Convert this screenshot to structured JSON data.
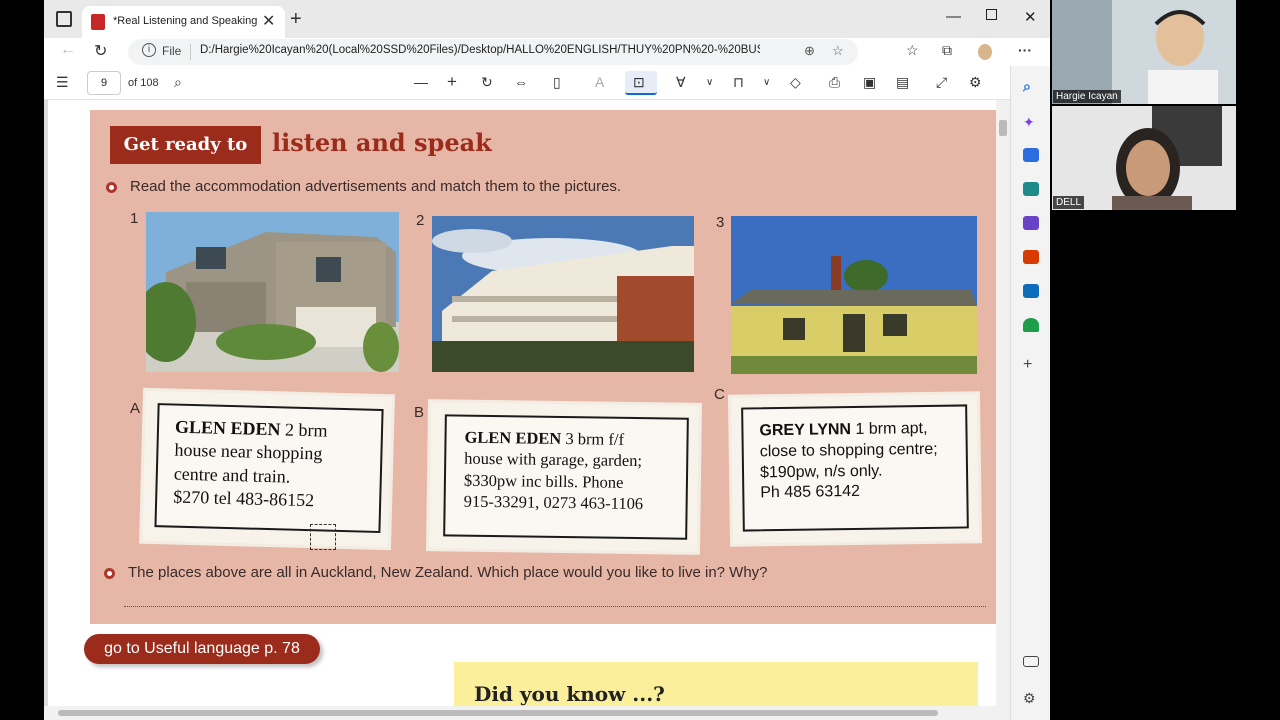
{
  "browser": {
    "tab_title": "*Real Listening and Speaking 2.p",
    "address_label": "File",
    "url": "D:/Hargie%20Icayan%20(Local%20SSD%20Files)/Desktop/HALLO%20ENGLISH/THUY%20PN%20-%20BUSINESS%20A2/R..."
  },
  "pdf_toolbar": {
    "page_number": "9",
    "page_total": "of 108"
  },
  "lesson": {
    "heading_box": "Get ready to",
    "heading_rest": "listen and speak",
    "instruction1": "Read the accommodation advertisements and match them to the pictures.",
    "photo_numbers": [
      "1",
      "2",
      "3"
    ],
    "ad_letters": [
      "A",
      "B",
      "C"
    ],
    "ads": [
      {
        "place": "GLEN EDEN",
        "line1": " 2 brm",
        "line2": "house near shopping",
        "line3": "centre and train.",
        "line4": "$270 tel 483-86152"
      },
      {
        "place": "GLEN EDEN",
        "line1": " 3 brm f/f",
        "line2": "house with garage, garden;",
        "line3": "$330pw inc bills. Phone",
        "line4": "915-33291, 0273 463-1106"
      },
      {
        "place": "GREY LYNN",
        "line1": " 1 brm apt,",
        "line2": "close to shopping centre;",
        "line3": "$190pw, n/s only.",
        "line4": "Ph 485 63142"
      }
    ],
    "instruction2": "The places above are all in Auckland, New Zealand. Which place would you like to live in? Why?",
    "goto_label": "go to Useful language p. 78",
    "did_you_know": "Did you know ...?"
  },
  "participants": [
    {
      "name": "Hargie Icayan"
    },
    {
      "name": "DELL"
    }
  ],
  "colors": {
    "lesson_bg": "#e6b7a6",
    "accent_red": "#9b2b1a",
    "note_yellow": "#fbef9c"
  }
}
